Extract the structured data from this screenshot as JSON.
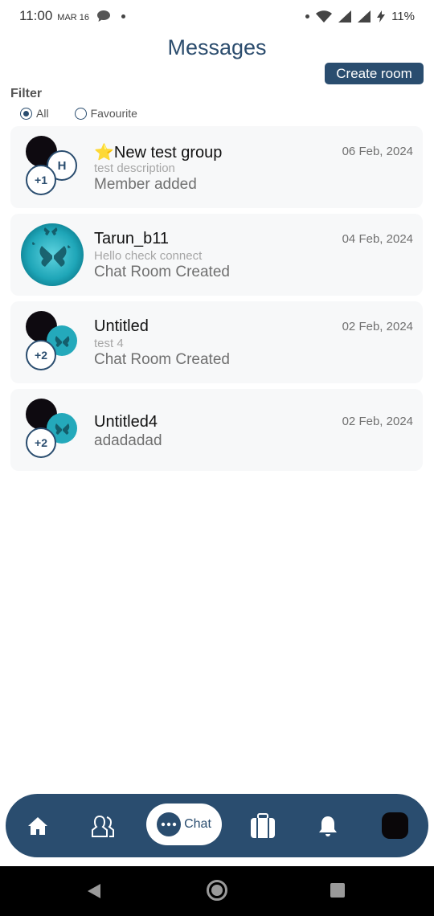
{
  "status_bar": {
    "time": "11:00",
    "date": "MAR 16",
    "battery": "11%",
    "icons": [
      "message-bubble-icon",
      "notification-dot-icon",
      "dot-icon",
      "wifi-icon",
      "signal-x-icon",
      "signal-icon",
      "charging-icon"
    ]
  },
  "header": {
    "title": "Messages",
    "create_room_label": "Create room"
  },
  "filter": {
    "label": "Filter",
    "options": [
      {
        "label": "All",
        "selected": true
      },
      {
        "label": "Favourite",
        "selected": false
      }
    ]
  },
  "chats": [
    {
      "favourite_icon": "⭐",
      "title": "New test group",
      "subtitle": "test description",
      "last_message": "Member added",
      "date": "06 Feb, 2024",
      "avatar_letter": "H",
      "avatar_count": "+1"
    },
    {
      "title": "Tarun_b11",
      "subtitle": "Hello check connect",
      "last_message": "Chat Room Created",
      "date": "04 Feb, 2024"
    },
    {
      "title": "Untitled",
      "subtitle": "test 4",
      "last_message": "Chat Room Created",
      "date": "02 Feb, 2024",
      "avatar_count": "+2"
    },
    {
      "title": "Untitled4",
      "last_message": "adadadad",
      "date": "02 Feb, 2024",
      "avatar_count": "+2"
    }
  ],
  "bottom_nav": {
    "active_label": "Chat",
    "items": [
      "home-icon",
      "people-icon",
      "chat-icon",
      "briefcase-icon",
      "bell-icon",
      "profile-icon"
    ]
  },
  "colors": {
    "primary": "#2a4d6f",
    "card_bg": "#f7f8f9",
    "muted_text": "#707070"
  }
}
